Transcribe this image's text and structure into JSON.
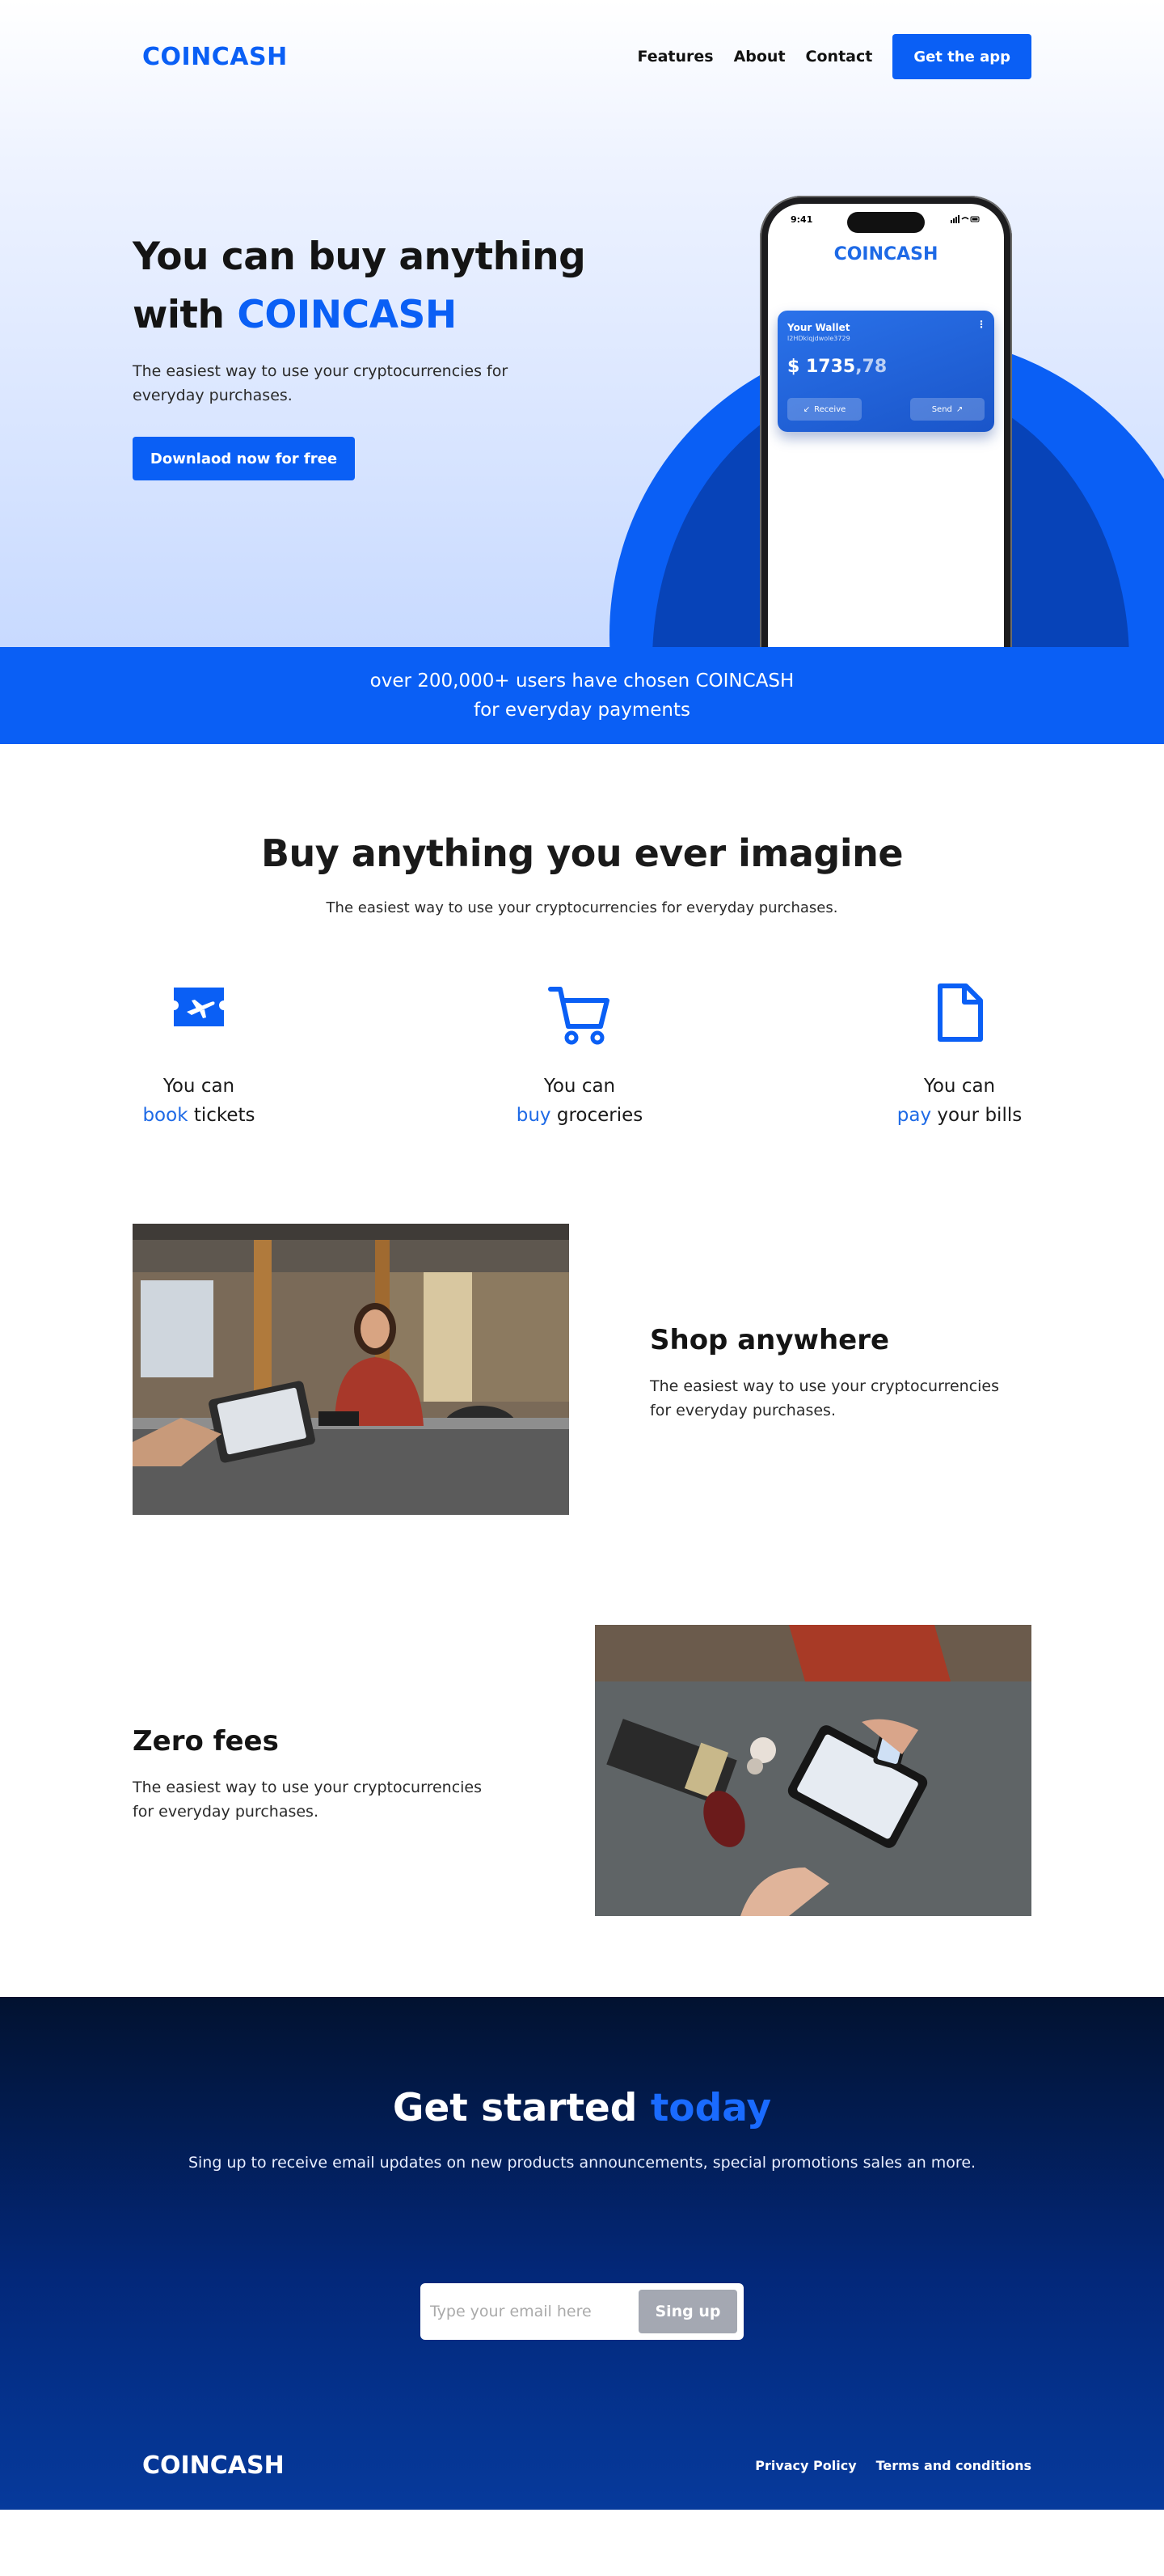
{
  "brand": {
    "name": "COINCASH",
    "accent_color": "#0a5ff5",
    "dark_color": "#021230"
  },
  "nav": {
    "links": [
      "Features",
      "About",
      "Contact"
    ],
    "cta": "Get the app"
  },
  "hero": {
    "title_line1": "You can buy anything",
    "title_line2_prefix": "with ",
    "title_line2_accent": "COINCASH",
    "subtitle": "The easiest way to use your cryptocurrencies for everyday purchases.",
    "button": "Downlaod now for free"
  },
  "phone": {
    "time": "9:41",
    "status_icons": "signal-wifi-battery-icons",
    "app_name": "COINCASH",
    "wallet": {
      "title": "Your Wallet",
      "id": "l2HDkiqjdwole3729",
      "balance_main": "$ 1735",
      "balance_cents": ",78",
      "receive": "Receive",
      "send": "Send"
    }
  },
  "banner": {
    "line1": "over 200,000+ users have chosen COINCASH",
    "line2": "for everyday payments"
  },
  "buy": {
    "title": "Buy anything you ever imagine",
    "subtitle": "The easiest way to use your cryptocurrencies for everyday purchases.",
    "features": [
      {
        "icon": "ticket-plane-icon",
        "line1": "You can",
        "accent": "book",
        "rest": " tickets"
      },
      {
        "icon": "shopping-cart-icon",
        "line1": "You can",
        "accent": "buy",
        "rest": " groceries"
      },
      {
        "icon": "document-icon",
        "line1": "You can",
        "accent": "pay",
        "rest": " your bills"
      }
    ]
  },
  "shop": {
    "title": "Shop anywhere",
    "text": "The easiest way to use your cryptocurrencies for everyday purchases.",
    "image": "shop-counter-photo"
  },
  "fees": {
    "title": "Zero fees",
    "text": "The easiest way to use your cryptocurrencies for everyday purchases.",
    "image": "tablet-payment-photo"
  },
  "cta": {
    "title_prefix": "Get started ",
    "title_accent": "today",
    "subtitle": "Sing up to receive email updates on new products announcements, special promotions sales an more.",
    "email_placeholder": "Type your email here",
    "button": "Sing up"
  },
  "footer": {
    "logo": "COINCASH",
    "links": [
      "Privacy Policy",
      "Terms and conditions"
    ]
  }
}
